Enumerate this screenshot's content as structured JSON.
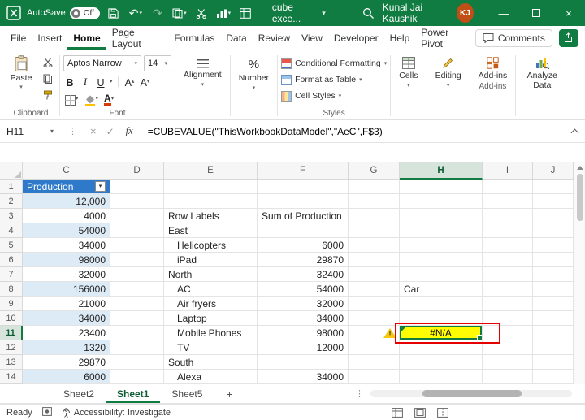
{
  "colors": {
    "excel-green": "#107C41",
    "table-header-blue": "#2E79C9",
    "band-blue": "#DDEBF7",
    "highlight-yellow": "#FFFD00",
    "annotation-red": "#E50000",
    "header-select": "#D7E4DC",
    "avatar-orange": "#C04F15"
  },
  "titlebar": {
    "autosave_label": "AutoSave",
    "autosave_state": "Off",
    "filename": "cube exce...",
    "user_name": "Kunal Jai Kaushik",
    "user_initials": "KJ"
  },
  "menu": {
    "tabs": [
      "File",
      "Insert",
      "Home",
      "Page Layout",
      "Formulas",
      "Data",
      "Review",
      "View",
      "Developer",
      "Help",
      "Power Pivot"
    ],
    "comments_label": "Comments"
  },
  "ribbon": {
    "paste": "Paste",
    "clipboard_group": "Clipboard",
    "font_name": "Aptos Narrow",
    "font_size": "14",
    "font_group": "Font",
    "alignment": "Alignment",
    "number": "Number",
    "conditional_formatting": "Conditional Formatting",
    "format_as_table": "Format as Table",
    "cell_styles": "Cell Styles",
    "styles_group": "Styles",
    "cells": "Cells",
    "editing": "Editing",
    "addins": "Add-ins",
    "addins_group": "Add-ins",
    "analyze_data": "Analyze Data"
  },
  "formula_bar": {
    "name_box": "H11",
    "formula": "=CUBEVALUE(\"ThisWorkbookDataModel\",\"AeC\",F$3)"
  },
  "grid": {
    "columns": [
      "C",
      "D",
      "E",
      "F",
      "G",
      "H",
      "I",
      "J"
    ],
    "selected_cell": "H11",
    "rows": [
      {
        "n": "1",
        "c": "Production"
      },
      {
        "n": "2",
        "c": "12,000"
      },
      {
        "n": "3",
        "c": "4000",
        "e": "Row Labels",
        "f": "Sum of Production"
      },
      {
        "n": "4",
        "c": "54000",
        "e": "East"
      },
      {
        "n": "5",
        "c": "34000",
        "e": "Helicopters",
        "f": "6000"
      },
      {
        "n": "6",
        "c": "98000",
        "e": "iPad",
        "f": "29870"
      },
      {
        "n": "7",
        "c": "32000",
        "e": "North",
        "f": "32400"
      },
      {
        "n": "8",
        "c": "156000",
        "e": "AC",
        "f": "54000",
        "h": "Car"
      },
      {
        "n": "9",
        "c": "21000",
        "e": "Air fryers",
        "f": "32000"
      },
      {
        "n": "10",
        "c": "34000",
        "e": "Laptop",
        "f": "34000"
      },
      {
        "n": "11",
        "c": "23400",
        "e": "Mobile Phones",
        "f": "98000",
        "h": "#N/A"
      },
      {
        "n": "12",
        "c": "1320",
        "e": "TV",
        "f": "12000"
      },
      {
        "n": "13",
        "c": "29870",
        "e": "South"
      },
      {
        "n": "14",
        "c": "6000",
        "e": "Alexa",
        "f": "34000"
      }
    ]
  },
  "sheet_tabs": {
    "tabs": [
      "Sheet2",
      "Sheet1",
      "Sheet5"
    ],
    "add_label": "+"
  },
  "status_bar": {
    "ready": "Ready",
    "accessibility": "Accessibility: Investigate"
  },
  "icons": {
    "undo": "↶",
    "redo": "↷",
    "chevron_down": "▾",
    "dots": "⋮",
    "cancel": "×",
    "enter": "✓",
    "fx": "fx",
    "warning": "!",
    "percent": "%",
    "bold": "B",
    "italic": "I",
    "underline": "U",
    "font_a": "A",
    "minimize": "—"
  }
}
